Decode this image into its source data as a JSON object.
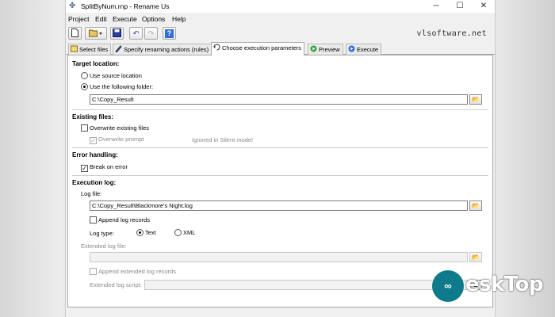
{
  "window": {
    "title": "SplitByNum.rnp - Rename Us"
  },
  "menu": [
    {
      "label": "Project"
    },
    {
      "label": "Edit"
    },
    {
      "label": "Execute"
    },
    {
      "label": "Options"
    },
    {
      "label": "Help"
    }
  ],
  "toolbar": {
    "brand": "vlsoftware.net"
  },
  "tabs": [
    {
      "label": "Select files"
    },
    {
      "label": "Specify renaming actions (rules)"
    },
    {
      "label": "Choose execution parameters"
    },
    {
      "label": "Preview"
    },
    {
      "label": "Execute"
    }
  ],
  "target": {
    "heading": "Target location:",
    "use_source": "Use source location",
    "use_folder": "Use the following folder:",
    "folder_value": "C:\\Copy_Result",
    "selected": "use_folder"
  },
  "existing": {
    "heading": "Existing files:",
    "overwrite_label": "Overwrite existing files",
    "overwrite_checked": false,
    "prompt_label": "Overwrite prompt",
    "prompt_checked": true,
    "silent_note": "Ignored in Silent mode!"
  },
  "errors": {
    "heading": "Error handling:",
    "break_label": "Break on error",
    "break_checked": true
  },
  "log": {
    "heading": "Execution log:",
    "file_label": "Log file:",
    "file_value": "C:\\Copy_Result\\Blackmore's Night.log",
    "append_label": "Append log records",
    "append_checked": false,
    "type_label": "Log type:",
    "type_text": "Text",
    "type_xml": "XML",
    "type_selected": "Text",
    "ext_file_label": "Extended log file:",
    "ext_file_value": "",
    "ext_append_label": "Append extended log records",
    "ext_script_label": "Extended log script:"
  },
  "watermark": {
    "text": "eskTop"
  }
}
